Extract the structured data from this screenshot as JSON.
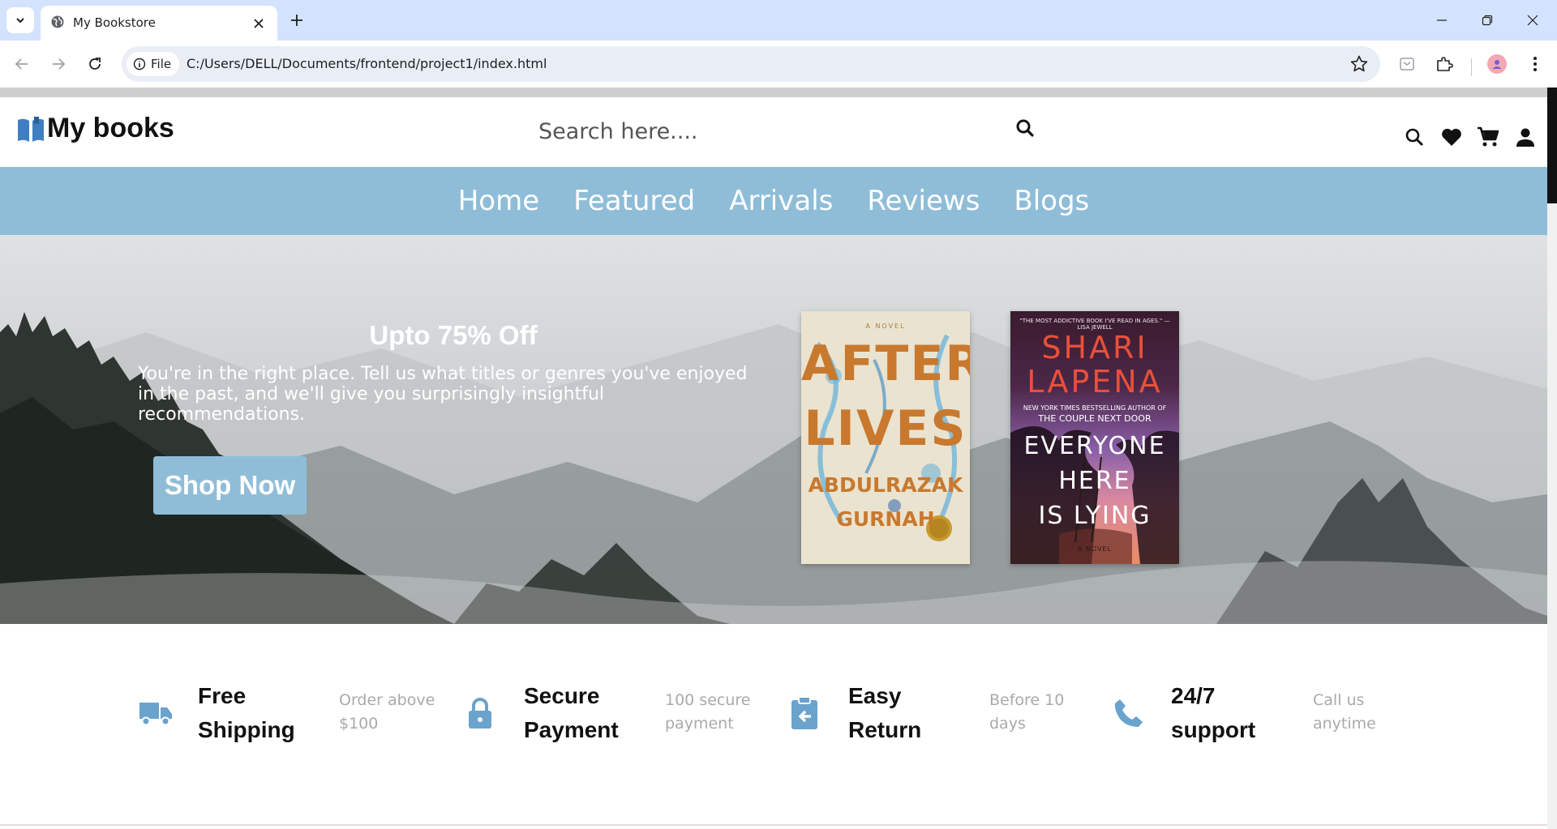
{
  "browser": {
    "tab_title": "My Bookstore",
    "site_chip": "File",
    "url": "C:/Users/DELL/Documents/frontend/project1/index.html"
  },
  "header": {
    "logo_text": "My books",
    "search_placeholder": "Search here...."
  },
  "nav": {
    "items": [
      "Home",
      "Featured",
      "Arrivals",
      "Reviews",
      "Blogs"
    ]
  },
  "hero": {
    "title": "Upto 75% Off",
    "description": "You're in the right place. Tell us what titles or genres you've enjoyed in the past, and we'll give you surprisingly insightful recommendations.",
    "button": "Shop Now",
    "book1": {
      "subtitle": "A NOVEL",
      "title_line1": "AFTER",
      "title_line2": "LIVES",
      "author_line1": "ABDULRAZAK",
      "author_line2": "GURNAH"
    },
    "book2": {
      "quote": "\"THE MOST ADDICTIVE BOOK I'VE READ IN AGES.\" —LISA JEWELL",
      "author_line1": "SHARI",
      "author_line2": "LAPENA",
      "blurb_line1": "NEW YORK TIMES BESTSELLING AUTHOR OF",
      "blurb_line2": "THE COUPLE NEXT DOOR",
      "title_line1": "EVERYONE",
      "title_line2": "HERE",
      "title_line3": "IS LYING",
      "footer": "A NOVEL"
    }
  },
  "features": [
    {
      "icon": "truck-icon",
      "title_line1": "Free",
      "title_line2": "Shipping",
      "sub_line1": "Order above",
      "sub_line2": "$100"
    },
    {
      "icon": "lock-icon",
      "title_line1": "Secure",
      "title_line2": "Payment",
      "sub_line1": "100 secure",
      "sub_line2": "payment"
    },
    {
      "icon": "return-icon",
      "title_line1": "Easy",
      "title_line2": "Return",
      "sub_line1": "Before 10",
      "sub_line2": "days"
    },
    {
      "icon": "phone-icon",
      "title_line1": "24/7",
      "title_line2": "support",
      "sub_line1": "Call us",
      "sub_line2": "anytime"
    }
  ],
  "colors": {
    "accent": "#8fbdd8",
    "icon_blue": "#6aa3cc",
    "chrome_tabbar": "#d3e3fd"
  }
}
